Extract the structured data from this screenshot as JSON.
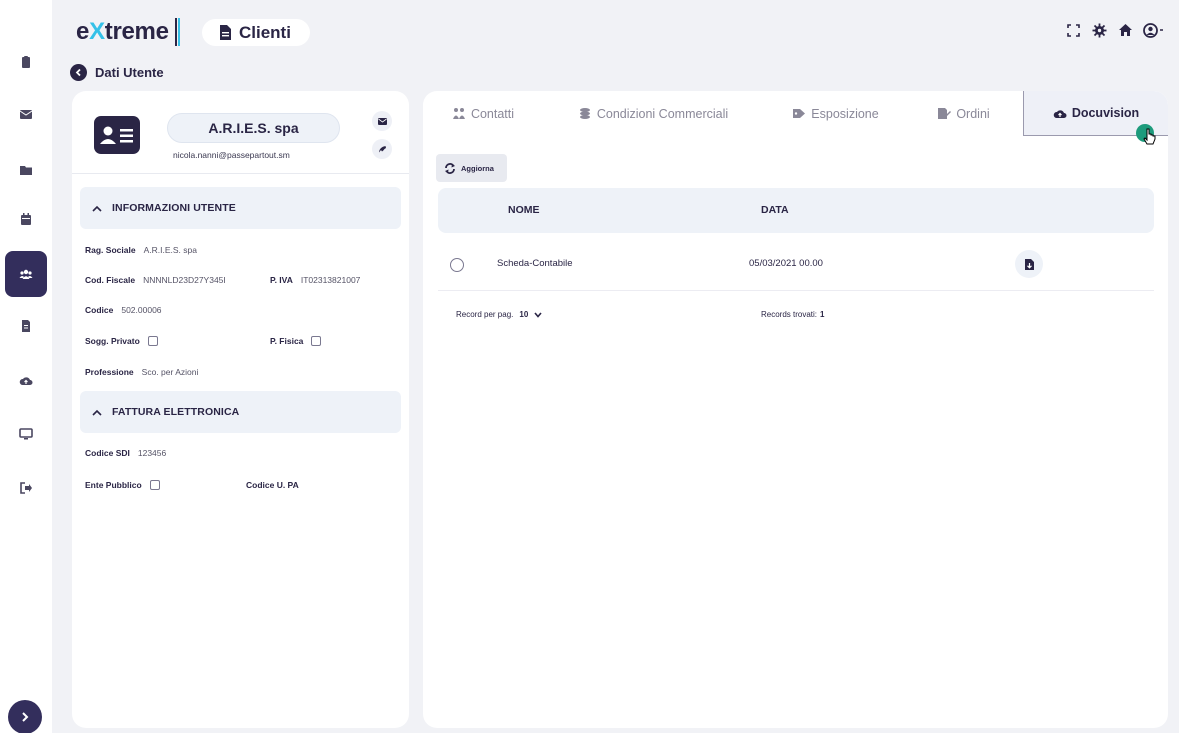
{
  "app": {
    "logo_prefix": "e",
    "logo_x": "X",
    "logo_suffix": "treme",
    "page_title": "Clienti",
    "breadcrumb": "Dati Utente"
  },
  "sidebar": {
    "items": [
      {
        "icon": "clipboard-icon"
      },
      {
        "icon": "envelope-icon"
      },
      {
        "icon": "folder-icon"
      },
      {
        "icon": "calendar-icon"
      },
      {
        "icon": "users-icon",
        "active": true
      },
      {
        "icon": "document-icon"
      },
      {
        "icon": "cloud-upload-icon"
      },
      {
        "icon": "monitor-icon"
      },
      {
        "icon": "sign-out-icon"
      }
    ]
  },
  "topbar_icons": [
    "fullscreen-icon",
    "settings-icon",
    "home-icon",
    "user-icon"
  ],
  "user_card": {
    "name": "A.R.I.E.S. spa",
    "email": "nicola.nanni@passepartout.sm"
  },
  "info_section": {
    "title": "INFORMAZIONI UTENTE",
    "rag_sociale_label": "Rag. Sociale",
    "rag_sociale_value": "A.R.I.E.S. spa",
    "cod_fiscale_label": "Cod. Fiscale",
    "cod_fiscale_value": "NNNNLD23D27Y345I",
    "piva_label": "P. IVA",
    "piva_value": "IT02313821007",
    "codice_label": "Codice",
    "codice_value": "502.00006",
    "sogg_privato_label": "Sogg. Privato",
    "sogg_privato_checked": false,
    "p_fisica_label": "P. Fisica",
    "p_fisica_checked": false,
    "professione_label": "Professione",
    "professione_value": "Sco. per Azioni"
  },
  "fattura_section": {
    "title": "FATTURA ELETTRONICA",
    "codice_sdi_label": "Codice SDI",
    "codice_sdi_value": "123456",
    "ente_pubblico_label": "Ente Pubblico",
    "ente_pubblico_checked": false,
    "codice_upa_label": "Codice U. PA",
    "codice_upa_value": ""
  },
  "tabs": [
    {
      "label": "Contatti",
      "icon": "contacts-icon"
    },
    {
      "label": "Condizioni Commerciali",
      "icon": "coins-icon"
    },
    {
      "label": "Esposizione",
      "icon": "tags-icon"
    },
    {
      "label": "Ordini",
      "icon": "edit-document-icon"
    },
    {
      "label": "Docuvision",
      "icon": "cloud-upload-icon",
      "active": true
    }
  ],
  "docuvision": {
    "refresh_label": "Aggiorna",
    "columns": [
      "NOME",
      "DATA"
    ],
    "rows": [
      {
        "nome": "Scheda-Contabile",
        "data": "05/03/2021 00.00"
      }
    ],
    "per_page_label": "Record per pag.",
    "per_page_value": "10",
    "records_found_label": "Records trovati:",
    "records_found_value": "1"
  },
  "colors": {
    "primary": "#332e5c",
    "accent": "#35c1e8",
    "background": "#f1f2f6",
    "cursor_dot": "#1d9b7c"
  }
}
